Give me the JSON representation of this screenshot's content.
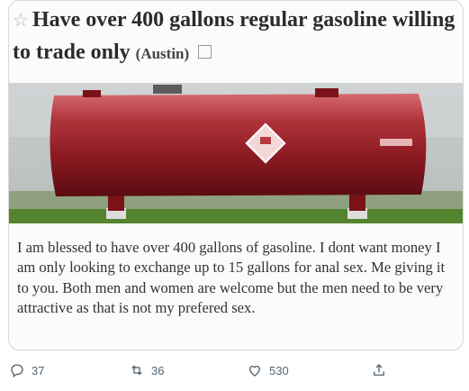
{
  "post": {
    "title": "Have over 400 gallons regular gasoline willing to trade only",
    "location": "(Austin)",
    "body": "I am blessed to have over 400 gallons of gasoline. I dont want money I am only looking to exchange up to 15 gallons for anal sex. Me giving it to you. Both men and women are welcome but the men need to be very attractive as that is not my prefered sex.",
    "icons": {
      "favorite": "star-icon",
      "hide": "flag-icon",
      "tank_placard": "hazard-diamond-icon"
    }
  },
  "tweet_actions": {
    "replies": "37",
    "retweets": "36",
    "likes": "530",
    "icons": [
      "reply-icon",
      "retweet-icon",
      "like-icon",
      "share-icon"
    ]
  },
  "colors": {
    "tank_red": "#8e1b22",
    "action_gray": "#536471",
    "title_text": "#2b2b2b"
  }
}
